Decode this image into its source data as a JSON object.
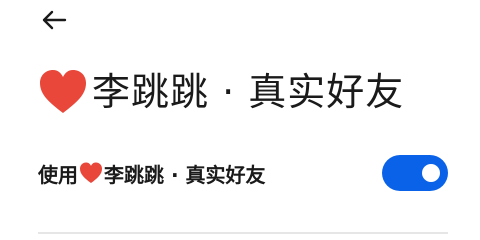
{
  "header": {
    "back_icon": "arrow-left-icon",
    "title_icon": "heart-icon",
    "title_text": "李跳跳 · 真实好友"
  },
  "setting": {
    "label_prefix": "使用",
    "label_icon": "heart-icon",
    "label_suffix": "李跳跳 · 真实好友",
    "toggle_on": true
  },
  "colors": {
    "heart": "#e8473a",
    "toggle_active": "#0a62e8",
    "text": "#1a1a1a"
  }
}
